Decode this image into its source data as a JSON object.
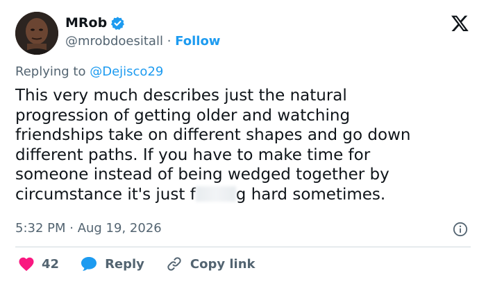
{
  "author": {
    "name": "MRob",
    "handle": "@mrobdoesitall",
    "separator": "·",
    "follow_label": "Follow"
  },
  "reply_context": {
    "prefix": "Replying to",
    "mention": "@Dejisco29"
  },
  "tweet": {
    "text_before_censor": "This very much describes just the natural\nprogression of getting older and watching\nfriendships take on different shapes and go down\ndifferent paths. If you have to make time for\nsomeone instead of being wedged together by\ncircumstance it's just f",
    "text_after_censor": "g hard sometimes.",
    "timestamp": "5:32 PM · Aug 19, 2026"
  },
  "actions": {
    "like_count": "42",
    "reply_label": "Reply",
    "copy_link_label": "Copy link"
  },
  "colors": {
    "accent": "#1d9bf0",
    "like": "#f91880",
    "secondary_text": "#536471",
    "primary_text": "#0f1419",
    "divider": "#cfd9de"
  },
  "icons": [
    "verified-badge-icon",
    "x-logo-icon",
    "info-icon",
    "heart-icon",
    "reply-bubble-icon",
    "link-icon"
  ]
}
